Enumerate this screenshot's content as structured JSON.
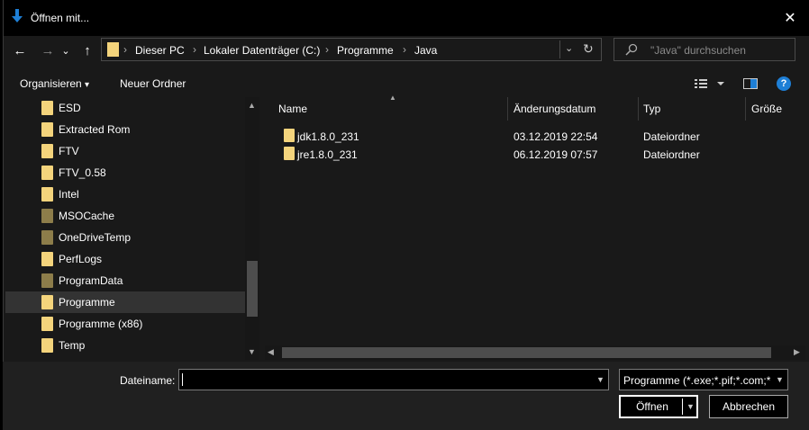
{
  "window": {
    "title": "Öffnen mit...",
    "close_glyph": "✕"
  },
  "nav": {
    "back_glyph": "←",
    "forward_glyph": "→",
    "recent_glyph": "⌄",
    "up_glyph": "↑",
    "refresh_glyph": "↻",
    "breadcrumb": [
      "Dieser PC",
      "Lokaler Datenträger (C:)",
      "Programme",
      "Java"
    ],
    "separator": "›",
    "search_placeholder": "\"Java\" durchsuchen"
  },
  "commandbar": {
    "organize_label": "Organisieren",
    "organize_arrow": "▾",
    "new_folder_label": "Neuer Ordner",
    "help_glyph": "?"
  },
  "tree": {
    "items": [
      {
        "label": "ESD",
        "dim": false,
        "selected": false
      },
      {
        "label": "Extracted Rom",
        "dim": false,
        "selected": false
      },
      {
        "label": "FTV",
        "dim": false,
        "selected": false
      },
      {
        "label": "FTV_0.58",
        "dim": false,
        "selected": false
      },
      {
        "label": "Intel",
        "dim": false,
        "selected": false
      },
      {
        "label": "MSOCache",
        "dim": true,
        "selected": false
      },
      {
        "label": "OneDriveTemp",
        "dim": true,
        "selected": false
      },
      {
        "label": "PerfLogs",
        "dim": false,
        "selected": false
      },
      {
        "label": "ProgramData",
        "dim": true,
        "selected": false
      },
      {
        "label": "Programme",
        "dim": false,
        "selected": true
      },
      {
        "label": "Programme (x86)",
        "dim": false,
        "selected": false
      },
      {
        "label": "Temp",
        "dim": false,
        "selected": false
      }
    ]
  },
  "files": {
    "columns": {
      "name": "Name",
      "date": "Änderungsdatum",
      "type": "Typ",
      "size": "Größe"
    },
    "rows": [
      {
        "name": "jdk1.8.0_231",
        "date": "03.12.2019 22:54",
        "type": "Dateiordner"
      },
      {
        "name": "jre1.8.0_231",
        "date": "06.12.2019 07:57",
        "type": "Dateiordner"
      }
    ]
  },
  "footer": {
    "filename_label": "Dateiname:",
    "filename_value": "",
    "filter_value": "Programme (*.exe;*.pif;*.com;*",
    "open_label": "Öffnen",
    "cancel_label": "Abbrechen"
  },
  "colors": {
    "folder": "#f4d47c",
    "folder_dim": "#8d7d4a",
    "background": "#191919",
    "selected": "#333333",
    "help_blue": "#1e7fd6"
  },
  "icons": [
    "download-arrow-icon",
    "close-icon",
    "back-arrow-icon",
    "forward-arrow-icon",
    "chevron-down-icon",
    "up-arrow-icon",
    "folder-icon",
    "refresh-icon",
    "search-icon",
    "view-options-icon",
    "preview-pane-icon",
    "help-icon"
  ]
}
